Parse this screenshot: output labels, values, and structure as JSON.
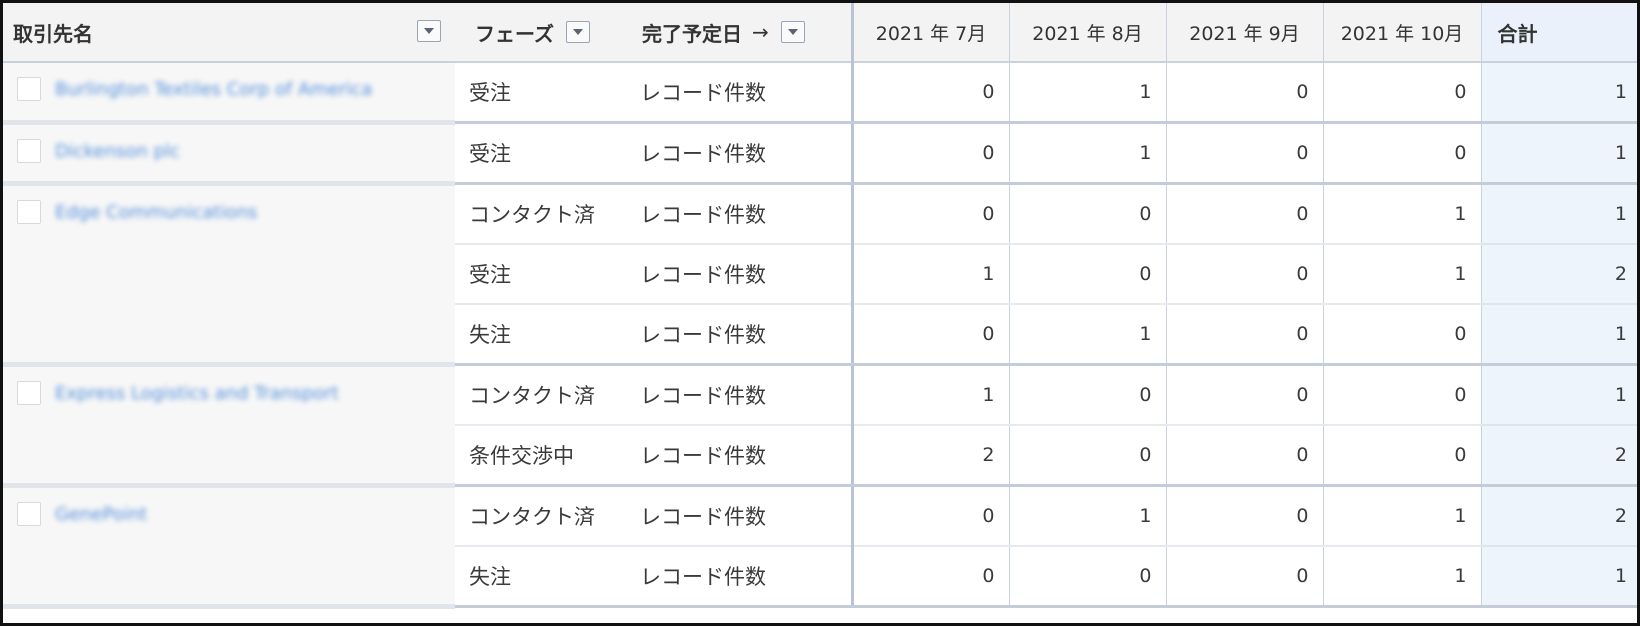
{
  "header": {
    "account_label": "取引先名",
    "phase_label": "フェーズ",
    "close_date_label": "完了予定日",
    "close_date_arrow": "→",
    "months": [
      "2021 年 7月",
      "2021 年 8月",
      "2021 年 9月",
      "2021 年 10月"
    ],
    "total_label": "合計"
  },
  "record_type_label": "レコード件数",
  "groups": [
    {
      "account": "Burlington Textiles Corp of America",
      "rows": [
        {
          "phase": "受注",
          "values": [
            "0",
            "1",
            "0",
            "0"
          ],
          "total": "1"
        }
      ]
    },
    {
      "account": "Dickenson plc",
      "rows": [
        {
          "phase": "受注",
          "values": [
            "0",
            "1",
            "0",
            "0"
          ],
          "total": "1"
        }
      ]
    },
    {
      "account": "Edge Communications",
      "rows": [
        {
          "phase": "コンタクト済",
          "values": [
            "0",
            "0",
            "0",
            "1"
          ],
          "total": "1"
        },
        {
          "phase": "受注",
          "values": [
            "1",
            "0",
            "0",
            "1"
          ],
          "total": "2"
        },
        {
          "phase": "失注",
          "values": [
            "0",
            "1",
            "0",
            "0"
          ],
          "total": "1"
        }
      ]
    },
    {
      "account": "Express Logistics and Transport",
      "rows": [
        {
          "phase": "コンタクト済",
          "values": [
            "1",
            "0",
            "0",
            "0"
          ],
          "total": "1"
        },
        {
          "phase": "条件交渉中",
          "values": [
            "2",
            "0",
            "0",
            "0"
          ],
          "total": "2"
        }
      ]
    },
    {
      "account": "GenePoint",
      "rows": [
        {
          "phase": "コンタクト済",
          "values": [
            "0",
            "1",
            "0",
            "1"
          ],
          "total": "2"
        },
        {
          "phase": "失注",
          "values": [
            "0",
            "0",
            "0",
            "1"
          ],
          "total": "1"
        }
      ]
    }
  ]
}
